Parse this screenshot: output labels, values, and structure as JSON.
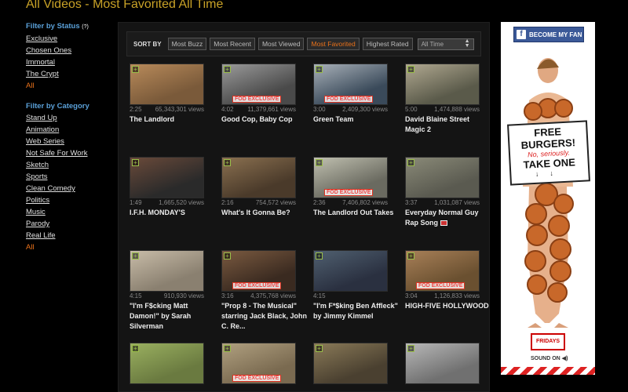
{
  "page_title": "All Videos - Most Favorited All Time",
  "filter_status": {
    "heading": "Filter by Status",
    "count": "(?)",
    "items": [
      "Exclusive",
      "Chosen Ones",
      "Immortal",
      "The Crypt",
      "All"
    ]
  },
  "filter_category": {
    "heading": "Filter by Category",
    "items": [
      "Stand Up",
      "Animation",
      "Web Series",
      "Not Safe For Work",
      "Sketch",
      "Sports",
      "Clean Comedy",
      "Politics",
      "Music",
      "Parody",
      "Real Life",
      "All"
    ]
  },
  "sort": {
    "label": "SORT BY",
    "buttons": [
      "Most Buzz",
      "Most Recent",
      "Most Viewed",
      "Most Favorited",
      "Highest Rated"
    ],
    "period": "All Time"
  },
  "badge_text": "FOD EXCLUSIVE",
  "videos": [
    {
      "duration": "2:25",
      "views": "65,343,301 views",
      "title": "The Landlord"
    },
    {
      "duration": "4:02",
      "views": "11,379,661 views",
      "title": "Good Cop, Baby Cop"
    },
    {
      "duration": "3:00",
      "views": "2,409,300 views",
      "title": "Green Team"
    },
    {
      "duration": "5:00",
      "views": "1,474,888 views",
      "title": "David Blaine Street Magic 2"
    },
    {
      "duration": "1:49",
      "views": "1,665,520 views",
      "title": "I.F.H. MONDAY'S"
    },
    {
      "duration": "2:16",
      "views": "754,572 views",
      "title": "What's It Gonna Be?"
    },
    {
      "duration": "2:36",
      "views": "7,406,802 views",
      "title": "The Landlord Out Takes"
    },
    {
      "duration": "3:37",
      "views": "1,031,087 views",
      "title": "Everyday Normal Guy Rap Song"
    },
    {
      "duration": "4:15",
      "views": "910,930 views",
      "title": "\"I'm F$cking Matt Damon!\" by Sarah Silverman"
    },
    {
      "duration": "3:16",
      "views": "4,375,768 views",
      "title": "\"Prop 8 - The Musical\" starring Jack Black, John C. Re..."
    },
    {
      "duration": "4:15",
      "views": "",
      "title": "\"I'm F*$king Ben Affleck\" by Jimmy Kimmel"
    },
    {
      "duration": "3:04",
      "views": "1,126,833 views",
      "title": "HIGH-FIVE HOLLYWOOD!"
    },
    {
      "duration": "",
      "views": "",
      "title": ""
    },
    {
      "duration": "",
      "views": "",
      "title": ""
    },
    {
      "duration": "",
      "views": "",
      "title": ""
    },
    {
      "duration": "",
      "views": "",
      "title": ""
    }
  ],
  "ad": {
    "fb_label": "BECOME MY FAN",
    "sign_line1": "FREE BURGERS!",
    "sign_line2": "No, seriously.",
    "sign_line3": "TAKE ONE",
    "logo": "FRIDAYS",
    "sound": "SOUND ON"
  },
  "colors": {
    "accent_orange": "#e8711a",
    "title_gold": "#c9a227",
    "heading_blue": "#5aa0d8",
    "badge_red": "#dd3322"
  }
}
